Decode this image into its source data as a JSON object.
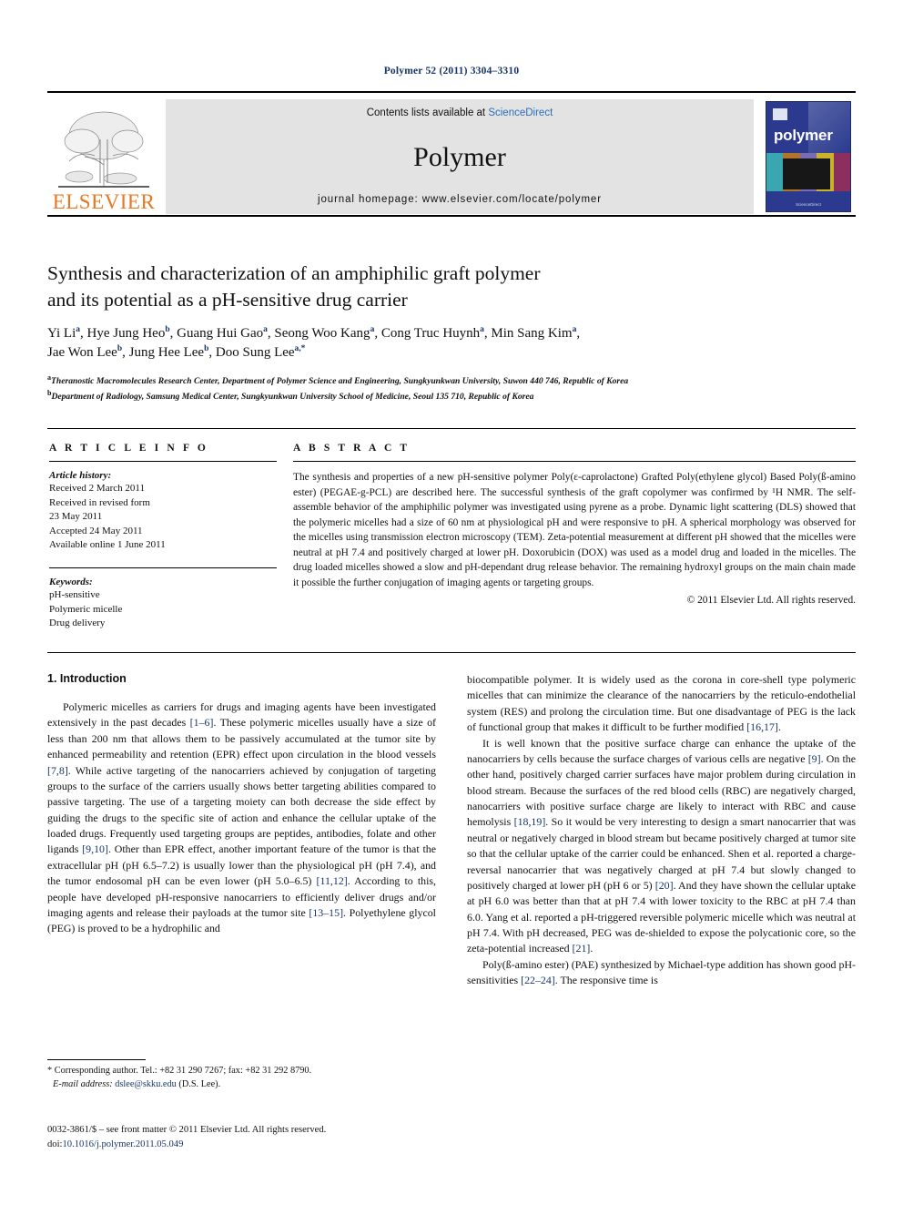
{
  "running_head": "Polymer 52 (2011) 3304–3310",
  "masthead": {
    "publisher_name": "ELSEVIER",
    "contents_text": "Contents lists available at ",
    "sciencedirect_link": "ScienceDirect",
    "journal_name": "Polymer",
    "homepage_line": "journal homepage: www.elsevier.com/locate/polymer",
    "cover_title": "polymer",
    "cover_footer": "ScienceDirect"
  },
  "article": {
    "title_line1": "Synthesis and characterization of an amphiphilic graft polymer",
    "title_line2": "and its potential as a pH-sensitive drug carrier",
    "authors": [
      {
        "name": "Yi Li",
        "sup": "a"
      },
      {
        "name": "Hye Jung Heo",
        "sup": "b"
      },
      {
        "name": "Guang Hui Gao",
        "sup": "a"
      },
      {
        "name": "Seong Woo Kang",
        "sup": "a"
      },
      {
        "name": "Cong Truc Huynh",
        "sup": "a"
      },
      {
        "name": "Min Sang Kim",
        "sup": "a"
      },
      {
        "name": "Jae Won Lee",
        "sup": "b"
      },
      {
        "name": "Jung Hee Lee",
        "sup": "b"
      },
      {
        "name": "Doo Sung Lee",
        "sup": "a,*"
      }
    ],
    "affiliations": [
      {
        "mark": "a",
        "text": "Theranostic Macromolecules Research Center, Department of Polymer Science and Engineering, Sungkyunkwan University, Suwon 440 746, Republic of Korea"
      },
      {
        "mark": "b",
        "text": "Department of Radiology, Samsung Medical Center, Sungkyunkwan University School of Medicine, Seoul 135 710, Republic of Korea"
      }
    ]
  },
  "article_info": {
    "heading": "A R T I C L E   I N F O",
    "history_label": "Article history:",
    "history": [
      "Received 2 March 2011",
      "Received in revised form",
      "23 May 2011",
      "Accepted 24 May 2011",
      "Available online 1 June 2011"
    ],
    "keywords_label": "Keywords:",
    "keywords": [
      "pH-sensitive",
      "Polymeric micelle",
      "Drug delivery"
    ]
  },
  "abstract": {
    "heading": "A B S T R A C T",
    "text": "The synthesis and properties of a new pH-sensitive polymer Poly(ε-caprolactone) Grafted Poly(ethylene glycol) Based Poly(ß-amino ester) (PEGAE-g-PCL) are described here. The successful synthesis of the graft copolymer was confirmed by ¹H NMR. The self-assemble behavior of the amphiphilic polymer was investigated using pyrene as a probe. Dynamic light scattering (DLS) showed that the polymeric micelles had a size of 60 nm at physiological pH and were responsive to pH. A spherical morphology was observed for the micelles using transmission electron microscopy (TEM). Zeta-potential measurement at different pH showed that the micelles were neutral at pH 7.4 and positively charged at lower pH. Doxorubicin (DOX) was used as a model drug and loaded in the micelles. The drug loaded micelles showed a slow and pH-dependant drug release behavior. The remaining hydroxyl groups on the main chain made it possible the further conjugation of imaging agents or targeting groups.",
    "copyright": "© 2011 Elsevier Ltd. All rights reserved."
  },
  "body": {
    "section_heading": "1. Introduction",
    "left_paragraphs": [
      "Polymeric micelles as carriers for drugs and imaging agents have been investigated extensively in the past decades [1–6]. These polymeric micelles usually have a size of less than 200 nm that allows them to be passively accumulated at the tumor site by enhanced permeability and retention (EPR) effect upon circulation in the blood vessels [7,8]. While active targeting of the nanocarriers achieved by conjugation of targeting groups to the surface of the carriers usually shows better targeting abilities compared to passive targeting. The use of a targeting moiety can both decrease the side effect by guiding the drugs to the specific site of action and enhance the cellular uptake of the loaded drugs. Frequently used targeting groups are peptides, antibodies, folate and other ligands [9,10]. Other than EPR effect, another important feature of the tumor is that the extracellular pH (pH 6.5–7.2) is usually lower than the physiological pH (pH 7.4), and the tumor endosomal pH can be even lower (pH 5.0–6.5) [11,12]. According to this, people have developed pH-responsive nanocarriers to efficiently deliver drugs and/or imaging agents and release their payloads at the tumor site [13–15]. Polyethylene glycol (PEG) is proved to be a hydrophilic and"
    ],
    "right_paragraphs": [
      "biocompatible polymer. It is widely used as the corona in core-shell type polymeric micelles that can minimize the clearance of the nanocarriers by the reticulo-endothelial system (RES) and prolong the circulation time. But one disadvantage of PEG is the lack of functional group that makes it difficult to be further modified [16,17].",
      "It is well known that the positive surface charge can enhance the uptake of the nanocarriers by cells because the surface charges of various cells are negative [9]. On the other hand, positively charged carrier surfaces have major problem during circulation in blood stream. Because the surfaces of the red blood cells (RBC) are negatively charged, nanocarriers with positive surface charge are likely to interact with RBC and cause hemolysis [18,19]. So it would be very interesting to design a smart nanocarrier that was neutral or negatively charged in blood stream but became positively charged at tumor site so that the cellular uptake of the carrier could be enhanced. Shen et al. reported a charge-reversal nanocarrier that was negatively charged at pH 7.4 but slowly changed to positively charged at lower pH (pH 6 or 5) [20]. And they have shown the cellular uptake at pH 6.0 was better than that at pH 7.4 with lower toxicity to the RBC at pH 7.4 than 6.0. Yang et al. reported a pH-triggered reversible polymeric micelle which was neutral at pH 7.4. With pH decreased, PEG was de-shielded to expose the polycationic core, so the zeta-potential increased [21].",
      "Poly(ß-amino ester) (PAE) synthesized by Michael-type addition has shown good pH-sensitivities [22–24]. The responsive time is"
    ]
  },
  "footnote": {
    "corresponding": "* Corresponding author. Tel.: +82 31 290 7267; fax: +82 31 292 8790.",
    "email_label": "E-mail address:",
    "email": "dslee@skku.edu",
    "email_suffix": "(D.S. Lee)."
  },
  "footer": {
    "issn_line": "0032-3861/$ – see front matter © 2011 Elsevier Ltd. All rights reserved.",
    "doi_label": "doi:",
    "doi": "10.1016/j.polymer.2011.05.049"
  },
  "colors": {
    "link_blue": "#2a6ebb",
    "ref_navy": "#17356b",
    "elsevier_orange": "#e87722",
    "cover_blue": "#2b3a8f",
    "banner_gray": "#e3e3e3"
  }
}
